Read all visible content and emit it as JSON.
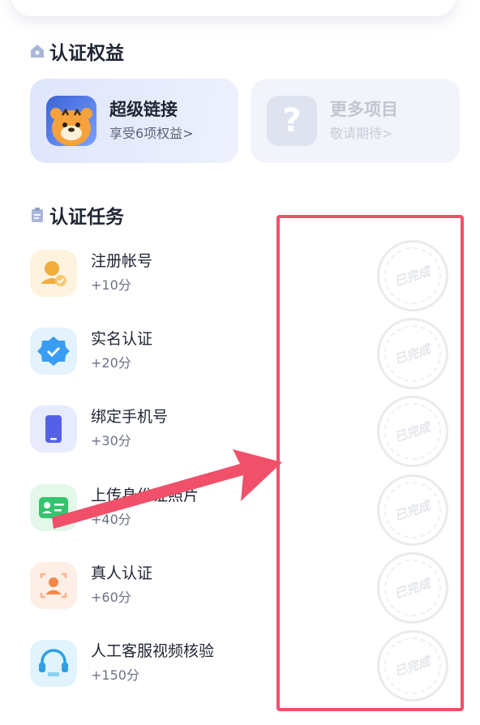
{
  "benefits": {
    "title": "认证权益",
    "cards": [
      {
        "name": "超级链接",
        "subtitle": "享受6项权益",
        "chevron": ">"
      },
      {
        "name": "更多项目",
        "subtitle": "敬请期待",
        "chevron": ">",
        "thumb_glyph": "?"
      }
    ]
  },
  "tasks": {
    "title": "认证任务",
    "items": [
      {
        "name": "注册帐号",
        "points": "+10分",
        "status": "已完成",
        "icon": "user-check-icon",
        "icon_bg": "#fdf3df",
        "icon_color": "#f2ad3c"
      },
      {
        "name": "实名认证",
        "points": "+20分",
        "status": "已完成",
        "icon": "verified-badge-icon",
        "icon_bg": "#e3f2fd",
        "icon_color": "#3a9cf2"
      },
      {
        "name": "绑定手机号",
        "points": "+30分",
        "status": "已完成",
        "icon": "phone-icon",
        "icon_bg": "#e8ebfd",
        "icon_color": "#5560e8"
      },
      {
        "name": "上传身份证照片",
        "points": "+40分",
        "status": "已完成",
        "icon": "id-card-icon",
        "icon_bg": "#e3f7ea",
        "icon_color": "#34c46e"
      },
      {
        "name": "真人认证",
        "points": "+60分",
        "status": "已完成",
        "icon": "face-scan-icon",
        "icon_bg": "#fdeee6",
        "icon_color": "#f2894a"
      },
      {
        "name": "人工客服视频核验",
        "points": "+150分",
        "status": "已完成",
        "icon": "headset-icon",
        "icon_bg": "#e1f3fc",
        "icon_color": "#2ea0e6"
      }
    ]
  },
  "colors": {
    "highlight": "#f0506a",
    "accent_blue": "#aab6d8"
  }
}
